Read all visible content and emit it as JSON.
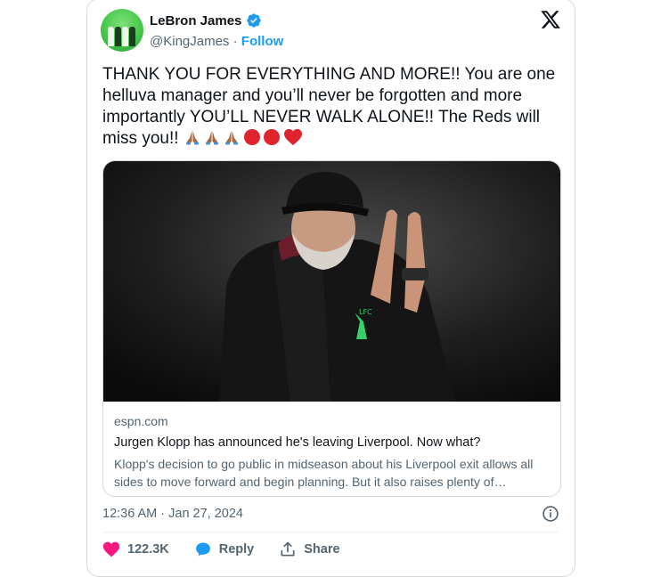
{
  "author": {
    "name": "LeBron James",
    "handle": "@KingJames",
    "separator": "·",
    "follow_label": "Follow",
    "verified_icon": "verified-badge-icon"
  },
  "tweet": {
    "text": "THANK YOU FOR EVERYTHING AND MORE!! You are one helluva manager and you’ll never be forgotten and more importantly YOU’LL NEVER WALK ALONE!! The Reds will miss you!!",
    "emojis": [
      "folded-hands",
      "folded-hands",
      "folded-hands",
      "red-circle",
      "red-circle",
      "red-heart"
    ]
  },
  "link_card": {
    "domain": "espn.com",
    "headline": "Jurgen Klopp has announced he's leaving Liverpool. Now what?",
    "description": "Klopp's decision to go public in midseason about his Liverpool exit allows all sides to move forward and begin planning. But it also raises plenty of…"
  },
  "timestamp": "12:36 AM · Jan 27, 2024",
  "actions": {
    "likes": "122.3K",
    "reply_label": "Reply",
    "share_label": "Share"
  },
  "colors": {
    "accent": "#1d9bf0",
    "like": "#f91880",
    "muted": "#536471"
  }
}
